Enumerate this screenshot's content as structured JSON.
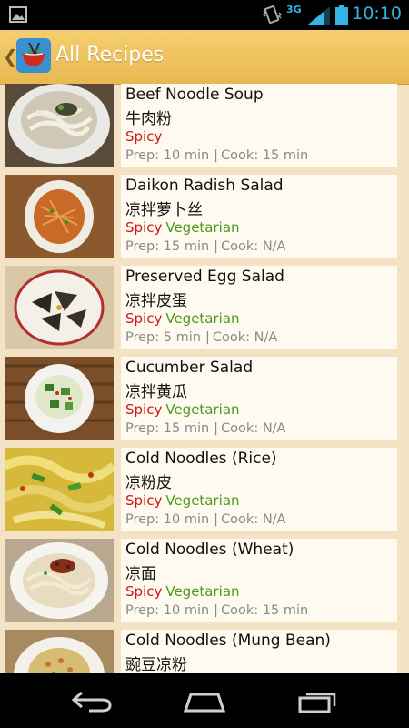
{
  "status_bar": {
    "time": "10:10",
    "network": "3G",
    "icons": [
      "gallery-icon",
      "vibrate-icon",
      "signal-icon",
      "battery-icon"
    ],
    "accent_color": "#33b5e5"
  },
  "action_bar": {
    "title": "All Recipes",
    "icon": "noodle-bowl-app-icon",
    "background_color": "#f0c45e"
  },
  "recipes": [
    {
      "name_en": "Beef Noodle Soup",
      "name_zh": "牛肉粉",
      "spicy": "Spicy",
      "vegetarian": "",
      "prep_label": "Prep:",
      "prep": "10 min",
      "sep": "|",
      "cook_label": "Cook:",
      "cook": "15 min"
    },
    {
      "name_en": "Daikon Radish Salad",
      "name_zh": "凉拌萝卜丝",
      "spicy": "Spicy",
      "vegetarian": "Vegetarian",
      "prep_label": "Prep:",
      "prep": "15 min",
      "sep": "|",
      "cook_label": "Cook:",
      "cook": "N/A"
    },
    {
      "name_en": "Preserved Egg Salad",
      "name_zh": "凉拌皮蛋",
      "spicy": "Spicy",
      "vegetarian": "Vegetarian",
      "prep_label": "Prep:",
      "prep": "5 min",
      "sep": "|",
      "cook_label": "Cook:",
      "cook": "N/A"
    },
    {
      "name_en": "Cucumber Salad",
      "name_zh": "凉拌黄瓜",
      "spicy": "Spicy",
      "vegetarian": "Vegetarian",
      "prep_label": "Prep:",
      "prep": "15 min",
      "sep": "|",
      "cook_label": "Cook:",
      "cook": "N/A"
    },
    {
      "name_en": "Cold Noodles (Rice)",
      "name_zh": "凉粉皮",
      "spicy": "Spicy",
      "vegetarian": "Vegetarian",
      "prep_label": "Prep:",
      "prep": "10 min",
      "sep": "|",
      "cook_label": "Cook:",
      "cook": "N/A"
    },
    {
      "name_en": "Cold Noodles (Wheat)",
      "name_zh": "凉面",
      "spicy": "Spicy",
      "vegetarian": "Vegetarian",
      "prep_label": "Prep:",
      "prep": "10 min",
      "sep": "|",
      "cook_label": "Cook:",
      "cook": "15 min"
    },
    {
      "name_en": "Cold Noodles (Mung Bean)",
      "name_zh": "豌豆凉粉",
      "spicy": "",
      "vegetarian": "",
      "prep_label": "",
      "prep": "",
      "sep": "",
      "cook_label": "",
      "cook": ""
    }
  ],
  "colors": {
    "spicy": "#cc1a12",
    "vegetarian": "#4a9a1a",
    "meta": "#8a8a8a"
  },
  "nav_bar": {
    "icons": [
      "back-icon",
      "home-icon",
      "recent-apps-icon"
    ]
  }
}
